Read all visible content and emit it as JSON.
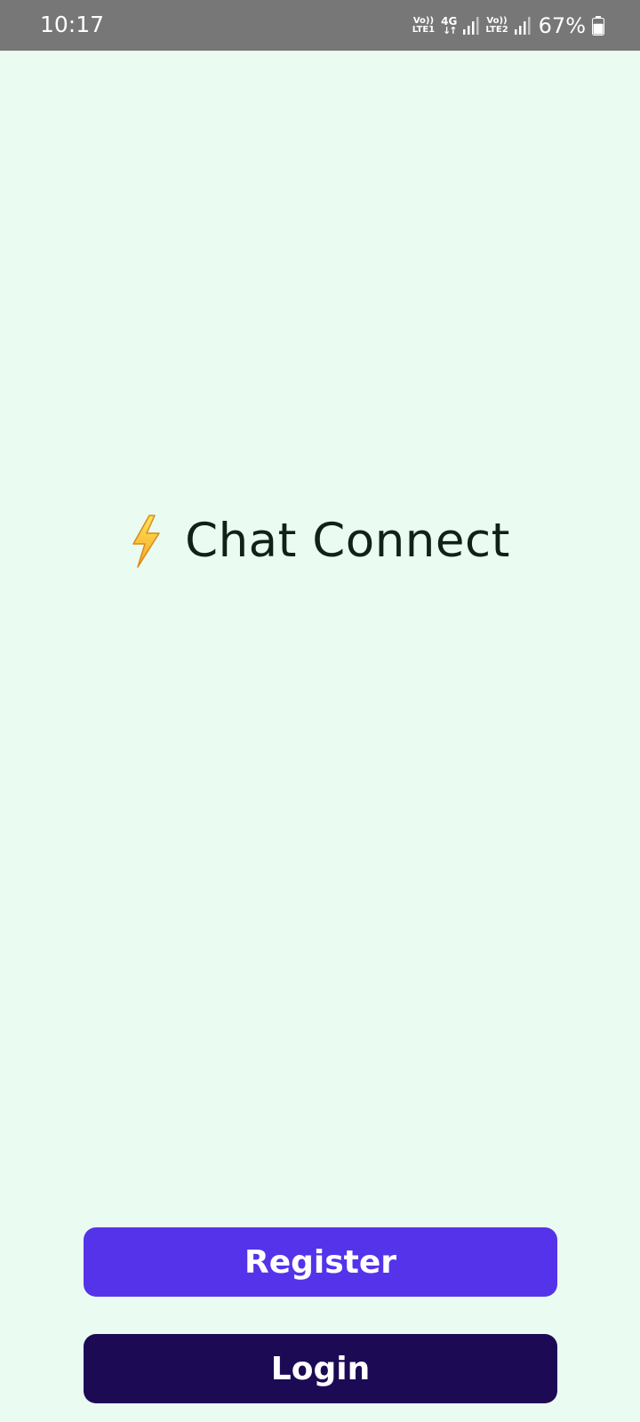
{
  "status_bar": {
    "time": "10:17",
    "sim1_top": "Vo))",
    "sim1_bottom": "LTE1",
    "network": "4G",
    "network_arrows": "↓↑",
    "sim2_top": "Vo))",
    "sim2_bottom": "LTE2",
    "battery_percent": "67%",
    "battery_level": 0.67,
    "icons": [
      "signal-icon",
      "signal-icon",
      "battery-icon"
    ]
  },
  "app": {
    "title": "Chat Connect",
    "title_icon": "lightning-bolt-icon"
  },
  "actions": {
    "register_label": "Register",
    "login_label": "Login"
  },
  "colors": {
    "background": "#eafcf1",
    "status_bar": "#777777",
    "register_button": "#5533ea",
    "login_button": "#1c0a55",
    "title_text": "#0f2216"
  }
}
